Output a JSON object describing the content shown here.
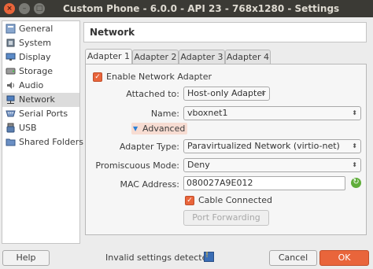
{
  "window": {
    "title": "Custom Phone - 6.0.0 - API 23 - 768x1280 - Settings"
  },
  "sidebar": {
    "items": [
      {
        "label": "General",
        "icon": "general-icon"
      },
      {
        "label": "System",
        "icon": "system-icon"
      },
      {
        "label": "Display",
        "icon": "display-icon"
      },
      {
        "label": "Storage",
        "icon": "storage-icon"
      },
      {
        "label": "Audio",
        "icon": "audio-icon"
      },
      {
        "label": "Network",
        "icon": "network-icon",
        "selected": true
      },
      {
        "label": "Serial Ports",
        "icon": "serial-ports-icon"
      },
      {
        "label": "USB",
        "icon": "usb-icon"
      },
      {
        "label": "Shared Folders",
        "icon": "shared-folders-icon"
      }
    ]
  },
  "page": {
    "title": "Network"
  },
  "tabs": [
    {
      "label": "Adapter 1",
      "active": true
    },
    {
      "label": "Adapter 2"
    },
    {
      "label": "Adapter 3"
    },
    {
      "label": "Adapter 4"
    }
  ],
  "adapter": {
    "enable_label": "Enable Network Adapter",
    "enable_checked": true,
    "attached_label": "Attached to:",
    "attached_value": "Host-only Adapter",
    "name_label": "Name:",
    "name_value": "vboxnet1",
    "advanced_label": "Advanced",
    "type_label": "Adapter Type:",
    "type_value": "Paravirtualized Network (virtio-net)",
    "promisc_label": "Promiscuous Mode:",
    "promisc_value": "Deny",
    "mac_label": "MAC Address:",
    "mac_value": "080027A9E012",
    "cable_label": "Cable Connected",
    "cable_checked": true,
    "port_forwarding_label": "Port Forwarding"
  },
  "footer": {
    "help_label": "Help",
    "status_text": "Invalid settings detected",
    "cancel_label": "Cancel",
    "ok_label": "OK"
  },
  "colors": {
    "accent": "#e9653b",
    "titlebar": "#3b3a35",
    "selected": "#dcdcdc"
  }
}
